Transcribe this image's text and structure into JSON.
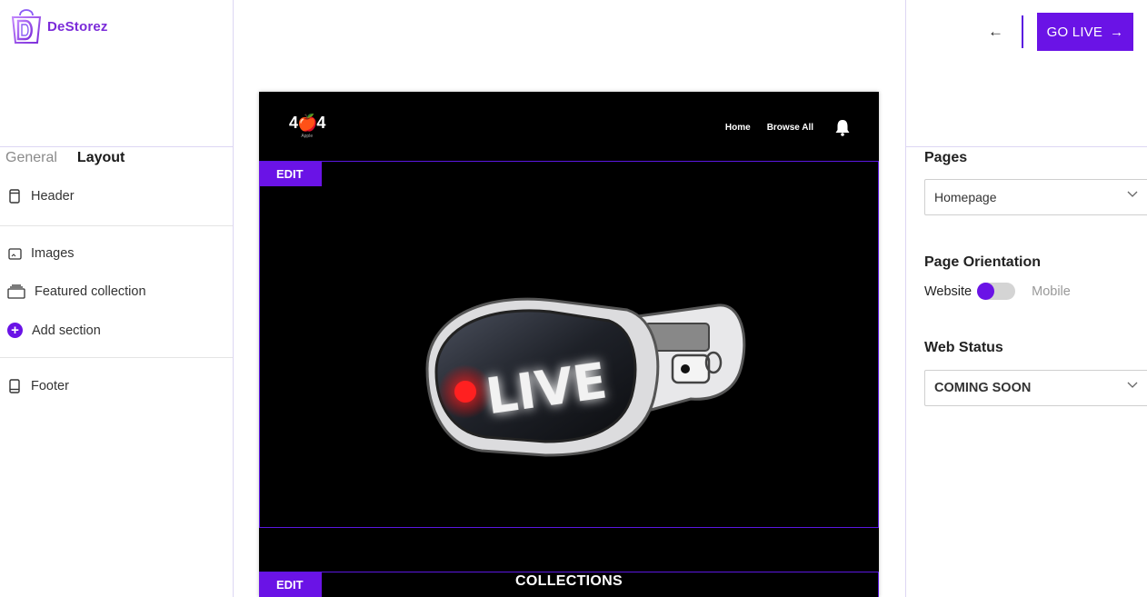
{
  "brand": {
    "name": "DeStorez"
  },
  "left": {
    "tabs": [
      {
        "label": "General",
        "active": false
      },
      {
        "label": "Layout",
        "active": true
      }
    ],
    "sections": [
      {
        "label": "Header",
        "icon": "phone-frame-icon"
      },
      {
        "label": "Images",
        "icon": "image-icon"
      },
      {
        "label": "Featured collection",
        "icon": "stack-icon"
      },
      {
        "label": "Add section",
        "icon": "plus-circle-icon"
      },
      {
        "label": "Footer",
        "icon": "phone-frame-icon"
      }
    ]
  },
  "toolbar": {
    "back_icon": "arrow-left-icon",
    "go_live_label": "GO LIVE",
    "go_live_icon": "arrow-right-icon"
  },
  "preview": {
    "logo_text": "4🍎4",
    "logo_sub": "Apple",
    "nav_links": [
      "Home",
      "Browse All"
    ],
    "bell_icon": "bell-icon",
    "edit_label": "EDIT",
    "banner_text": "LIVE",
    "collections_title": "COLLECTIONS"
  },
  "right": {
    "pages": {
      "heading": "Pages",
      "selected": "Homepage"
    },
    "orientation": {
      "heading": "Page Orientation",
      "option_a": "Website",
      "option_b": "Mobile",
      "selected": "Website"
    },
    "web_status": {
      "heading": "Web Status",
      "selected": "COMING SOON"
    }
  },
  "colors": {
    "accent": "#6a13e6",
    "brand_text": "#7b2bd9",
    "divider": "#ddd6f3"
  }
}
